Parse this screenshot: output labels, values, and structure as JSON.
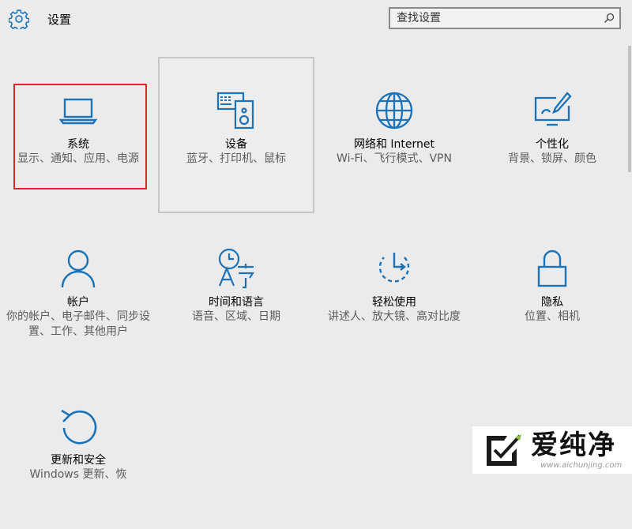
{
  "header": {
    "title": "设置",
    "search_placeholder": "查找设置"
  },
  "accent_color": "#1a73b8",
  "highlight_color": "#e0262b",
  "tiles": [
    {
      "name": "系统",
      "desc": "显示、通知、应用、电源",
      "icon": "laptop-icon"
    },
    {
      "name": "设备",
      "desc": "蓝牙、打印机、鼠标",
      "icon": "devices-icon"
    },
    {
      "name": "网络和 Internet",
      "desc": "Wi-Fi、飞行模式、VPN",
      "icon": "globe-icon"
    },
    {
      "name": "个性化",
      "desc": "背景、锁屏、颜色",
      "icon": "personalization-icon"
    },
    {
      "name": "帐户",
      "desc": "你的帐户、电子邮件、同步设置、工作、其他用户",
      "icon": "person-icon"
    },
    {
      "name": "时间和语言",
      "desc": "语音、区域、日期",
      "icon": "time-language-icon"
    },
    {
      "name": "轻松使用",
      "desc": "讲述人、放大镜、高对比度",
      "icon": "ease-of-access-icon"
    },
    {
      "name": "隐私",
      "desc": "位置、相机",
      "icon": "lock-icon"
    },
    {
      "name": "更新和安全",
      "desc": "Windows 更新、恢",
      "icon": "update-icon"
    }
  ],
  "watermark": {
    "text": "爱纯净",
    "url": "www.aichunjing.com"
  }
}
